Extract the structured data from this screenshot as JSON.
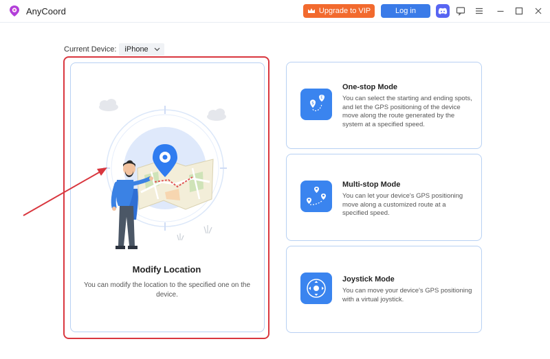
{
  "app": {
    "name": "AnyCoord"
  },
  "header": {
    "upgrade_label": "Upgrade to VIP",
    "login_label": "Log in",
    "icons": [
      "discord-icon",
      "feedback-icon",
      "menu-icon",
      "minimize-icon",
      "maximize-icon",
      "close-icon"
    ]
  },
  "device": {
    "label": "Current Device:",
    "value": "iPhone"
  },
  "modes": {
    "modify": {
      "title": "Modify Location",
      "desc": "You can modify the location to the specified one on the device."
    },
    "one_stop": {
      "title": "One-stop Mode",
      "desc": "You can select the starting and ending spots, and let the GPS positioning of the device move along the route generated by the system at a specified speed."
    },
    "multi_stop": {
      "title": "Multi-stop Mode",
      "desc": "You can let your device's GPS positioning move along a customized route at a specified speed."
    },
    "joystick": {
      "title": "Joystick Mode",
      "desc": "You can move your device's GPS positioning with a virtual joystick."
    }
  },
  "colors": {
    "accent": "#3a84ef",
    "vip": "#f26a2e",
    "login": "#3a7be8",
    "highlight": "#d9363e"
  }
}
